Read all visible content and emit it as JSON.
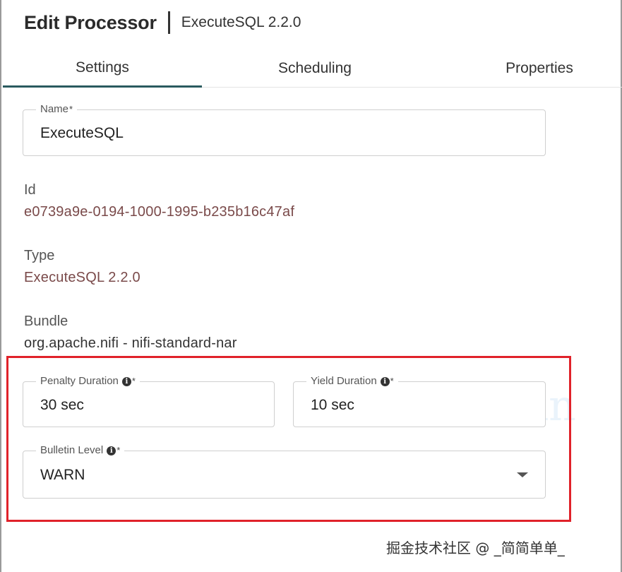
{
  "header": {
    "title": "Edit Processor",
    "subtitle": "ExecuteSQL 2.2.0"
  },
  "tabs": [
    {
      "label": "Settings",
      "active": true
    },
    {
      "label": "Scheduling",
      "active": false
    },
    {
      "label": "Properties",
      "active": false
    }
  ],
  "name_field": {
    "label": "Name",
    "required_mark": "*",
    "value": "ExecuteSQL"
  },
  "id": {
    "label": "Id",
    "value": "e0739a9e-0194-1000-1995-b235b16c47af"
  },
  "type": {
    "label": "Type",
    "value": "ExecuteSQL 2.2.0"
  },
  "bundle": {
    "label": "Bundle",
    "value": "org.apache.nifi - nifi-standard-nar"
  },
  "penalty_duration": {
    "label": "Penalty Duration",
    "required_mark": "*",
    "value": "30 sec"
  },
  "yield_duration": {
    "label": "Yield Duration",
    "required_mark": "*",
    "value": "10 sec"
  },
  "bulletin_level": {
    "label": "Bulletin Level",
    "required_mark": "*",
    "value": "WARN"
  },
  "info_glyph": "i",
  "watermark": "linxixin",
  "credit": "掘金技术社区 @ _简简单单_",
  "colors": {
    "highlight": "#e0222a",
    "active_tab": "#2a5a5f",
    "value_text": "#7a4a4a"
  }
}
